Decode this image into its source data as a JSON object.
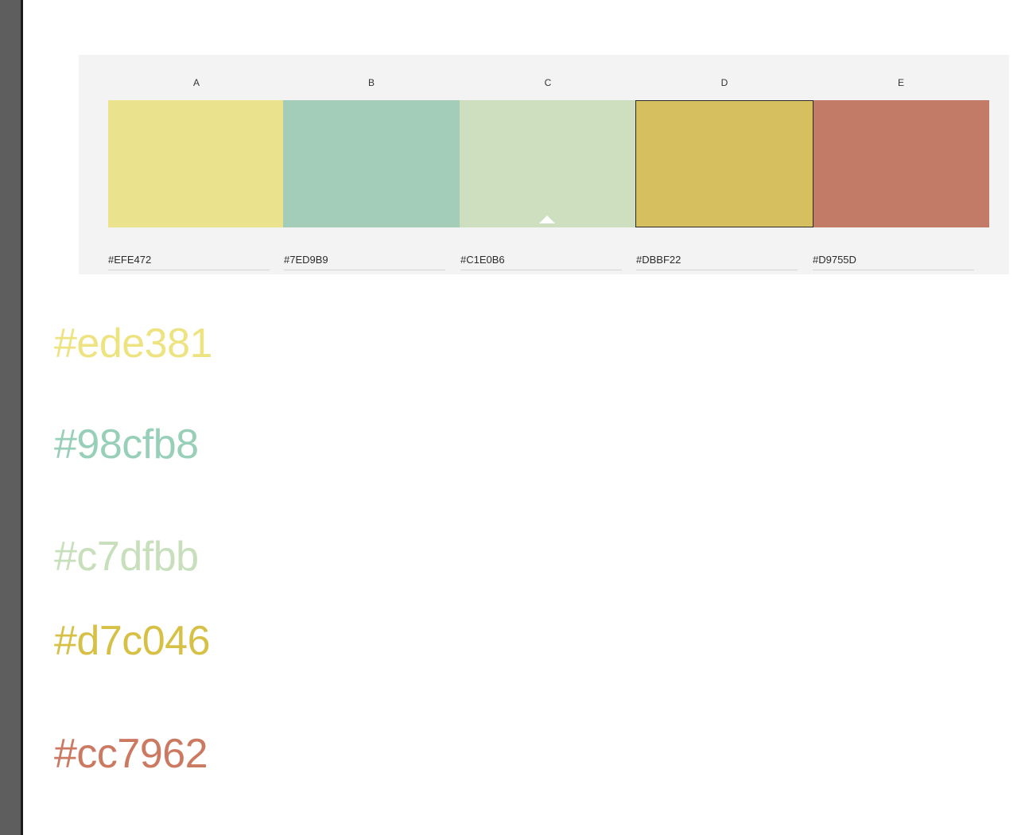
{
  "palette": {
    "labels": [
      "A",
      "B",
      "C",
      "D",
      "E"
    ],
    "hex_values": [
      "#EFE472",
      "#7ED9B9",
      "#C1E0B6",
      "#DBBF22",
      "#D9755D"
    ],
    "swatch_colors": [
      "#eae28c",
      "#a4cdb9",
      "#cedfbf",
      "#d5bf5e",
      "#c17b67"
    ],
    "selected_swatch": "D",
    "caret_under": "C"
  },
  "color_list": [
    {
      "text": "#ede381",
      "color": "#ede381"
    },
    {
      "text": "#98cfb8",
      "color": "#98cfb8"
    },
    {
      "text": "#c7dfbb",
      "color": "#c7dfbb"
    },
    {
      "text": "#d7c046",
      "color": "#d7c046"
    },
    {
      "text": "#cc7962",
      "color": "#cc7962"
    }
  ]
}
